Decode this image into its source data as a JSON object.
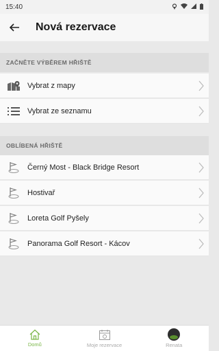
{
  "status_bar": {
    "time": "15:40"
  },
  "header": {
    "title": "Nová rezervace"
  },
  "section_start": {
    "title": "ZAČNĚTE VÝBĚREM HŘIŠTĚ",
    "items": [
      {
        "label": "Vybrat z mapy",
        "icon": "map-pin-icon"
      },
      {
        "label": "Vybrat ze seznamu",
        "icon": "list-icon"
      }
    ]
  },
  "section_favorites": {
    "title": "OBLÍBENÁ HŘIŠTĚ",
    "items": [
      {
        "label": "Černý Most - Black Bridge Resort",
        "icon": "golf-flag-icon"
      },
      {
        "label": "Hostivař",
        "icon": "golf-flag-icon"
      },
      {
        "label": "Loreta Golf Pyšely",
        "icon": "golf-flag-icon"
      },
      {
        "label": "Panorama Golf Resort - Kácov",
        "icon": "golf-flag-icon"
      }
    ]
  },
  "bottom_nav": {
    "items": [
      {
        "label": "Domů",
        "icon": "home-icon",
        "active": true
      },
      {
        "label": "Moje rezervace",
        "icon": "calendar-icon",
        "active": false
      },
      {
        "label": "Renata",
        "icon": "avatar",
        "active": false
      }
    ]
  },
  "colors": {
    "accent": "#7ab648",
    "header_bg": "#dedede",
    "page_bg": "#e9e9e9"
  }
}
